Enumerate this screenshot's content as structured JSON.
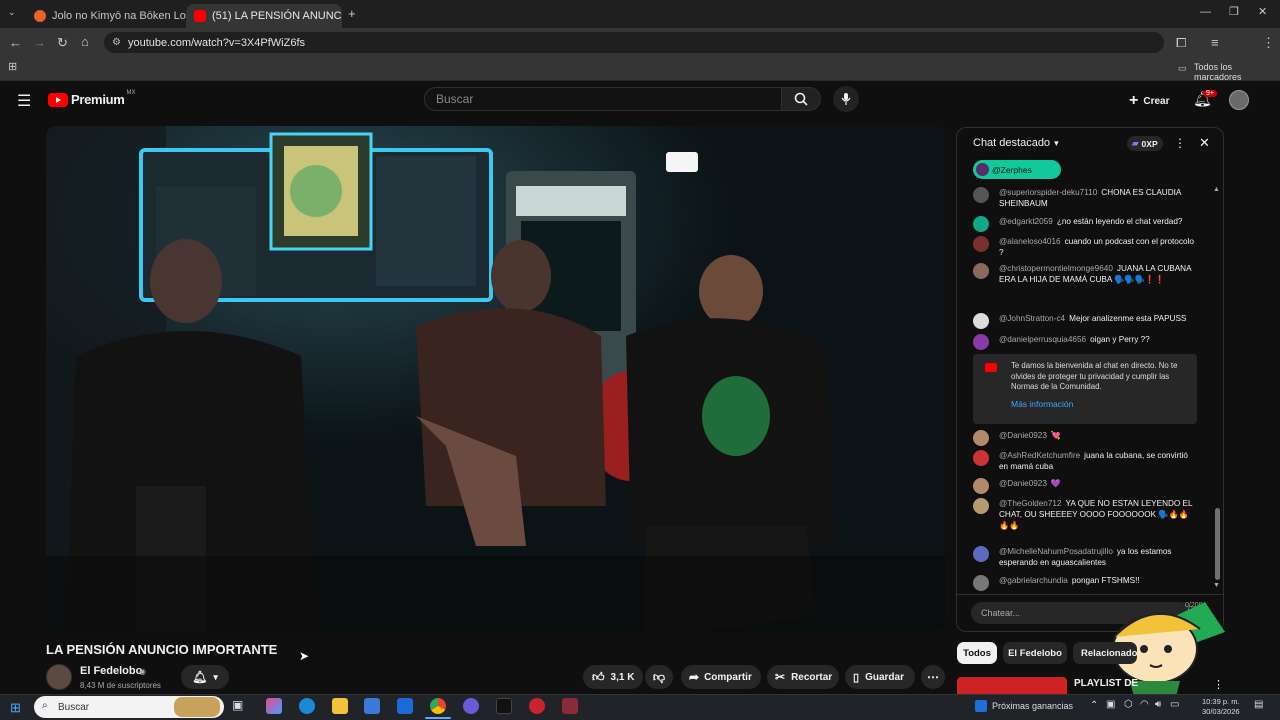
{
  "browser": {
    "tabs": [
      {
        "title": "Jolo no Kimyō na Bōken Los c",
        "active": false,
        "favicon_color": "#e8622a"
      },
      {
        "title": "(51) LA PENSIÓN ANUNCIO",
        "active": true,
        "favicon_color": "#ff0000"
      }
    ],
    "new_tab_label": "+",
    "url": "youtube.com/watch?v=3X4PfWiZ6fs",
    "bookmarks_all": "Todos los marcadores"
  },
  "youtube": {
    "logo_text": "Premium",
    "logo_region": "MX",
    "search_placeholder": "Buscar",
    "create_label": "Crear",
    "notifications_badge": "9+"
  },
  "video": {
    "title": "LA PENSIÓN ANUNCIO IMPORTANTE",
    "channel_name": "El Fedelobo",
    "subscribers": "8,43 M de suscriptores",
    "likes": "3,1 K",
    "share_label": "Compartir",
    "clip_label": "Recortar",
    "save_label": "Guardar"
  },
  "chat": {
    "header_title": "Chat destacado",
    "points": "0XP",
    "pinned_user": "@Zerphes",
    "messages": [
      {
        "user": "@superiorspider-deku7110",
        "text": "CHONA ES CLAUDIA SHEINBAUM",
        "avatar_color": "#555555"
      },
      {
        "user": "@edgarkt2059",
        "text": "¿no están leyendo el chat verdad?",
        "avatar_color": "#12a88a"
      },
      {
        "user": "@alaneloso4016",
        "text": "cuando un podcast con el protocolo ?",
        "avatar_color": "#7a3030"
      },
      {
        "user": "@christopermontielmonge9640",
        "text": "JUANA LA CUBANA ERA LA HIJA DE MAMÁ CUBA 🗣️🗣️🗣️❗❗",
        "avatar_color": "#8a6a5a"
      },
      {
        "user": "@JohnStratton-c4",
        "text": "Mejor analizenme esta PAPUSS",
        "avatar_color": "#dddddd"
      },
      {
        "user": "@danielperrusquia4656",
        "text": "oigan y Perry ??",
        "avatar_color": "#8a3aa8"
      },
      {
        "user": "@Danie0923",
        "text": "💘",
        "avatar_color": "#b08a6a"
      },
      {
        "user": "@AshRedKetchumfire",
        "text": "juana la cubana, se convirtió en mamá cuba",
        "avatar_color": "#cc3333"
      },
      {
        "user": "@Danie0923",
        "text": "💜",
        "avatar_color": "#b08a6a"
      },
      {
        "user": "@TheGolden712",
        "text": "YA QUE NO ESTAN LEYENDO EL CHAT, OU SHEEEEY OOOO FOOOOOOK 🗣️🔥🔥🔥🔥",
        "avatar_color": "#b89a70"
      },
      {
        "user": "@MichelleNahumPosadatrujillo",
        "text": "ya los estamos esperando en aguascalientes",
        "avatar_color": "#5c6bc0"
      },
      {
        "user": "@gabrielarchundia",
        "text": "pongan FTSHMS!!",
        "avatar_color": "#777777"
      }
    ],
    "welcome_text": "Te damos la bienvenida al chat en directo. No te olvides de proteger tu privacidad y cumplir las Normas de la Comunidad.",
    "welcome_link": "Más información",
    "input_placeholder": "Chatear...",
    "input_counter": "0/200"
  },
  "chips": [
    "Todos",
    "El Fedelobo",
    "Relacionado"
  ],
  "recommendation_title": "PLAYLIST DE",
  "taskbar": {
    "search_placeholder": "Buscar",
    "news_label": "Próximas ganancias",
    "time": "10:39 p. m.",
    "date": "30/03/2026"
  }
}
